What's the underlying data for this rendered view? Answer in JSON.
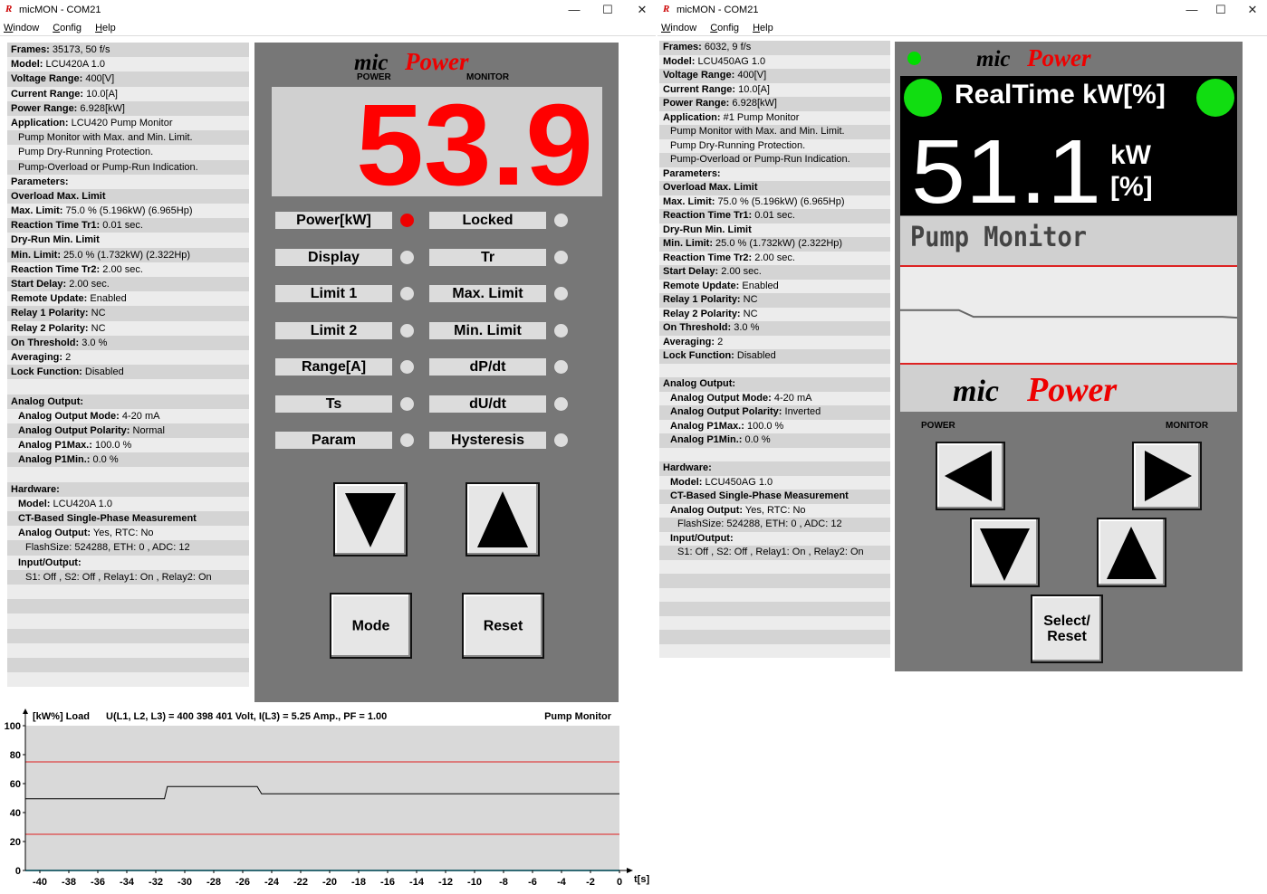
{
  "left": {
    "title": "micMON - COM21",
    "menu": [
      "Window",
      "Config",
      "Help"
    ],
    "info": [
      [
        "Frames:",
        " 35173, 50 f/s",
        0
      ],
      [
        "Model:",
        " LCU420A 1.0",
        0
      ],
      [
        "Voltage Range:",
        " 400[V]",
        0
      ],
      [
        "Current Range:",
        " 10.0[A]",
        0
      ],
      [
        "Power Range:",
        " 6.928[kW]",
        0
      ],
      [
        "Application:",
        " LCU420 Pump Monitor",
        0
      ],
      [
        "",
        "Pump Monitor with Max. and Min. Limit.",
        1
      ],
      [
        "",
        "Pump Dry-Running Protection.",
        1
      ],
      [
        "",
        "Pump-Overload or Pump-Run Indication.",
        1
      ],
      [
        "Parameters:",
        "",
        0
      ],
      [
        "Overload Max. Limit",
        "",
        0
      ],
      [
        "Max. Limit:",
        " 75.0 % (5.196kW) (6.965Hp)",
        0
      ],
      [
        "Reaction Time Tr1:",
        " 0.01 sec.",
        0
      ],
      [
        "Dry-Run Min. Limit",
        "",
        0
      ],
      [
        "Min. Limit:",
        " 25.0 % (1.732kW) (2.322Hp)",
        0
      ],
      [
        "Reaction Time Tr2:",
        " 2.00 sec.",
        0
      ],
      [
        "Start Delay:",
        " 2.00 sec.",
        0
      ],
      [
        "Remote Update:",
        " Enabled",
        0
      ],
      [
        "Relay 1 Polarity:",
        " NC",
        0
      ],
      [
        "Relay 2 Polarity:",
        " NC",
        0
      ],
      [
        "On Threshold:",
        " 3.0 %",
        0
      ],
      [
        "Averaging:",
        " 2",
        0
      ],
      [
        "Lock Function:",
        " Disabled",
        0
      ],
      [
        "",
        "",
        0
      ],
      [
        "Analog Output:",
        "",
        0
      ],
      [
        "Analog Output Mode:",
        " 4-20 mA",
        1
      ],
      [
        "Analog Output Polarity:",
        " Normal",
        1
      ],
      [
        "Analog P1Max.:",
        " 100.0 %",
        1
      ],
      [
        "Analog P1Min.:",
        " 0.0 %",
        1
      ],
      [
        "",
        "",
        0
      ],
      [
        "Hardware:",
        "",
        0
      ],
      [
        "Model:",
        " LCU420A 1.0",
        1
      ],
      [
        "CT-Based Single-Phase Measurement",
        "",
        1
      ],
      [
        "Analog Output:",
        " Yes, RTC: No",
        1
      ],
      [
        "",
        "FlashSize: 524288, ETH: 0 , ADC: 12",
        2
      ],
      [
        "Input/Output:",
        "",
        1
      ],
      [
        "",
        "S1: Off , S2: Off , Relay1: On , Relay2: On",
        2
      ],
      [
        "",
        "",
        0
      ],
      [
        "",
        "",
        0
      ],
      [
        "",
        "",
        0
      ],
      [
        "",
        "",
        0
      ],
      [
        "",
        "",
        0
      ],
      [
        "",
        "",
        0
      ],
      [
        "",
        "",
        0
      ]
    ],
    "brand": "micPower",
    "brand_left": "POWER",
    "brand_right": "MONITOR",
    "display": "53.9",
    "buttons": [
      "Power[kW]",
      "Locked",
      "Display",
      "Tr",
      "Limit 1",
      "Max. Limit",
      "Limit 2",
      "Min. Limit",
      "Range[A]",
      "dP/dt",
      "Ts",
      "dU/dt",
      "Param",
      "Hysteresis"
    ],
    "leds": [
      true,
      false,
      false,
      false,
      false,
      false,
      false,
      false,
      false,
      false,
      false,
      false,
      false,
      false
    ],
    "mode_label": "Mode",
    "reset_label": "Reset"
  },
  "chart_data": {
    "type": "line",
    "title": "U(L1, L2, L3) = 400 398 401 Volt, I(L3) = 5.25 Amp., PF = 1.00",
    "ylabel": "[kW%] Load",
    "right_label": "Pump Monitor",
    "xlabel": "t[s]",
    "ylim": [
      0,
      100
    ],
    "xlim": [
      -41,
      0
    ],
    "yticks": [
      0,
      20,
      40,
      60,
      80,
      100
    ],
    "xticks": [
      -40,
      -38,
      -36,
      -34,
      -32,
      -30,
      -28,
      -26,
      -24,
      -22,
      -20,
      -18,
      -16,
      -14,
      -12,
      -10,
      -8,
      -6,
      -4,
      -2,
      0
    ],
    "series": [
      {
        "x": [
          -41,
          -31.4,
          -31.2,
          -25,
          -24.7,
          0
        ],
        "y": [
          49.5,
          49.5,
          58,
          58,
          53,
          53
        ]
      }
    ],
    "limits": [
      75,
      25
    ],
    "colors": {
      "line": "#000000",
      "limit": "#e02020",
      "bg": "#d9d9d9",
      "zero": "#5fd3e8"
    }
  },
  "right": {
    "title": "micMON - COM21",
    "menu": [
      "Window",
      "Config",
      "Help"
    ],
    "info": [
      [
        "Frames:",
        " 6032, 9 f/s",
        0
      ],
      [
        "Model:",
        " LCU450AG 1.0",
        0
      ],
      [
        "Voltage Range:",
        " 400[V]",
        0
      ],
      [
        "Current Range:",
        " 10.0[A]",
        0
      ],
      [
        "Power Range:",
        " 6.928[kW]",
        0
      ],
      [
        "Application:",
        " #1 Pump Monitor",
        0
      ],
      [
        "",
        "Pump Monitor with Max. and Min. Limit.",
        1
      ],
      [
        "",
        "Pump Dry-Running Protection.",
        1
      ],
      [
        "",
        "Pump-Overload or Pump-Run Indication.",
        1
      ],
      [
        "Parameters:",
        "",
        0
      ],
      [
        "Overload Max. Limit",
        "",
        0
      ],
      [
        "Max. Limit:",
        " 75.0 % (5.196kW) (6.965Hp)",
        0
      ],
      [
        "Reaction Time Tr1:",
        " 0.01 sec.",
        0
      ],
      [
        "Dry-Run Min. Limit",
        "",
        0
      ],
      [
        "Min. Limit:",
        " 25.0 % (1.732kW) (2.322Hp)",
        0
      ],
      [
        "Reaction Time Tr2:",
        " 2.00 sec.",
        0
      ],
      [
        "Start Delay:",
        " 2.00 sec.",
        0
      ],
      [
        "Remote Update:",
        " Enabled",
        0
      ],
      [
        "Relay 1 Polarity:",
        " NC",
        0
      ],
      [
        "Relay 2 Polarity:",
        " NC",
        0
      ],
      [
        "On Threshold:",
        " 3.0 %",
        0
      ],
      [
        "Averaging:",
        " 2",
        0
      ],
      [
        "Lock Function:",
        " Disabled",
        0
      ],
      [
        "",
        "",
        0
      ],
      [
        "Analog Output:",
        "",
        0
      ],
      [
        "Analog Output Mode:",
        " 4-20 mA",
        1
      ],
      [
        "Analog Output Polarity:",
        " Inverted",
        1
      ],
      [
        "Analog P1Max.:",
        " 100.0 %",
        1
      ],
      [
        "Analog P1Min.:",
        " 0.0 %",
        1
      ],
      [
        "",
        "",
        0
      ],
      [
        "Hardware:",
        "",
        0
      ],
      [
        "Model:",
        " LCU450AG 1.0",
        1
      ],
      [
        "CT-Based Single-Phase Measurement",
        "",
        1
      ],
      [
        "Analog Output:",
        " Yes, RTC: No",
        1
      ],
      [
        "",
        "FlashSize: 524288, ETH: 0 , ADC: 12",
        2
      ],
      [
        "Input/Output:",
        "",
        1
      ],
      [
        "",
        "S1: Off , S2: Off , Relay1: On , Relay2: On",
        2
      ],
      [
        "",
        "",
        0
      ],
      [
        "",
        "",
        0
      ],
      [
        "",
        "",
        0
      ],
      [
        "",
        "",
        0
      ],
      [
        "",
        "",
        0
      ],
      [
        "",
        "",
        0
      ],
      [
        "",
        "",
        0
      ]
    ],
    "brand": "micPower",
    "header": "RealTime kW[%]",
    "value": "51.1",
    "unit1": "kW",
    "unit2": "[%]",
    "app": "Pump Monitor",
    "trend": [
      55,
      55,
      55,
      55,
      55,
      48,
      48,
      48,
      48,
      48,
      48,
      48,
      48,
      48,
      48,
      48,
      48,
      48,
      48,
      48,
      48,
      48,
      48,
      47
    ],
    "label_left": "POWER",
    "label_right": "MONITOR",
    "select_reset": [
      "Select/",
      "Reset"
    ]
  }
}
